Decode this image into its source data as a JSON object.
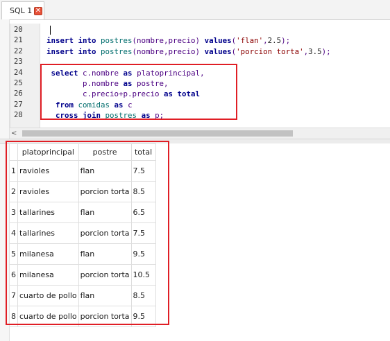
{
  "tab": {
    "label": "SQL 1",
    "close_glyph": "✕"
  },
  "editor": {
    "lines": [
      {
        "num": "20",
        "tokens": []
      },
      {
        "num": "21",
        "tokens": [
          {
            "t": "kw",
            "v": "insert "
          },
          {
            "t": "kw",
            "v": "into "
          },
          {
            "t": "id",
            "v": "postres"
          },
          {
            "t": "txt",
            "v": "(nombre,precio) "
          },
          {
            "t": "kw",
            "v": "values"
          },
          {
            "t": "txt",
            "v": "("
          },
          {
            "t": "str",
            "v": "'flan'"
          },
          {
            "t": "txt",
            "v": ","
          },
          {
            "t": "num",
            "v": "2.5"
          },
          {
            "t": "txt",
            "v": ");"
          }
        ]
      },
      {
        "num": "22",
        "tokens": [
          {
            "t": "kw",
            "v": "insert "
          },
          {
            "t": "kw",
            "v": "into "
          },
          {
            "t": "id",
            "v": "postres"
          },
          {
            "t": "txt",
            "v": "(nombre,precio) "
          },
          {
            "t": "kw",
            "v": "values"
          },
          {
            "t": "txt",
            "v": "("
          },
          {
            "t": "str",
            "v": "'porcion torta'"
          },
          {
            "t": "txt",
            "v": ","
          },
          {
            "t": "num",
            "v": "3.5"
          },
          {
            "t": "txt",
            "v": ");"
          }
        ]
      },
      {
        "num": "23",
        "tokens": []
      },
      {
        "num": "24",
        "tokens": [
          {
            "t": "txt",
            "v": " "
          },
          {
            "t": "kw",
            "v": "select "
          },
          {
            "t": "txt",
            "v": "c.nombre "
          },
          {
            "t": "kw",
            "v": "as "
          },
          {
            "t": "txt",
            "v": "platoprincipal,"
          }
        ]
      },
      {
        "num": "25",
        "tokens": [
          {
            "t": "txt",
            "v": "        p.nombre "
          },
          {
            "t": "kw",
            "v": "as "
          },
          {
            "t": "txt",
            "v": "postre,"
          }
        ]
      },
      {
        "num": "26",
        "tokens": [
          {
            "t": "txt",
            "v": "        c.precio+p.precio "
          },
          {
            "t": "kw",
            "v": "as "
          },
          {
            "t": "kw",
            "v": "total"
          }
        ]
      },
      {
        "num": "27",
        "tokens": [
          {
            "t": "txt",
            "v": "  "
          },
          {
            "t": "kw",
            "v": "from "
          },
          {
            "t": "id",
            "v": "comidas "
          },
          {
            "t": "kw",
            "v": "as "
          },
          {
            "t": "txt",
            "v": "c"
          }
        ]
      },
      {
        "num": "28",
        "tokens": [
          {
            "t": "txt",
            "v": "  "
          },
          {
            "t": "kw",
            "v": "cross "
          },
          {
            "t": "kw",
            "v": "join "
          },
          {
            "t": "id",
            "v": "postres "
          },
          {
            "t": "kw",
            "v": "as "
          },
          {
            "t": "txt",
            "v": "p;"
          }
        ]
      }
    ]
  },
  "scroll": {
    "left_arrow": "<"
  },
  "results": {
    "columns": [
      "platoprincipal",
      "postre",
      "total"
    ],
    "rows": [
      [
        "1",
        "ravioles",
        "flan",
        "7.5"
      ],
      [
        "2",
        "ravioles",
        "porcion torta",
        "8.5"
      ],
      [
        "3",
        "tallarines",
        "flan",
        "6.5"
      ],
      [
        "4",
        "tallarines",
        "porcion torta",
        "7.5"
      ],
      [
        "5",
        "milanesa",
        "flan",
        "9.5"
      ],
      [
        "6",
        "milanesa",
        "porcion torta",
        "10.5"
      ],
      [
        "7",
        "cuarto de pollo",
        "flan",
        "8.5"
      ],
      [
        "8",
        "cuarto de pollo",
        "porcion torta",
        "9.5"
      ]
    ]
  },
  "colors": {
    "highlight": "#e01e25",
    "keyword": "#00008b",
    "identifier": "#006d6d",
    "string": "#8b0000"
  }
}
